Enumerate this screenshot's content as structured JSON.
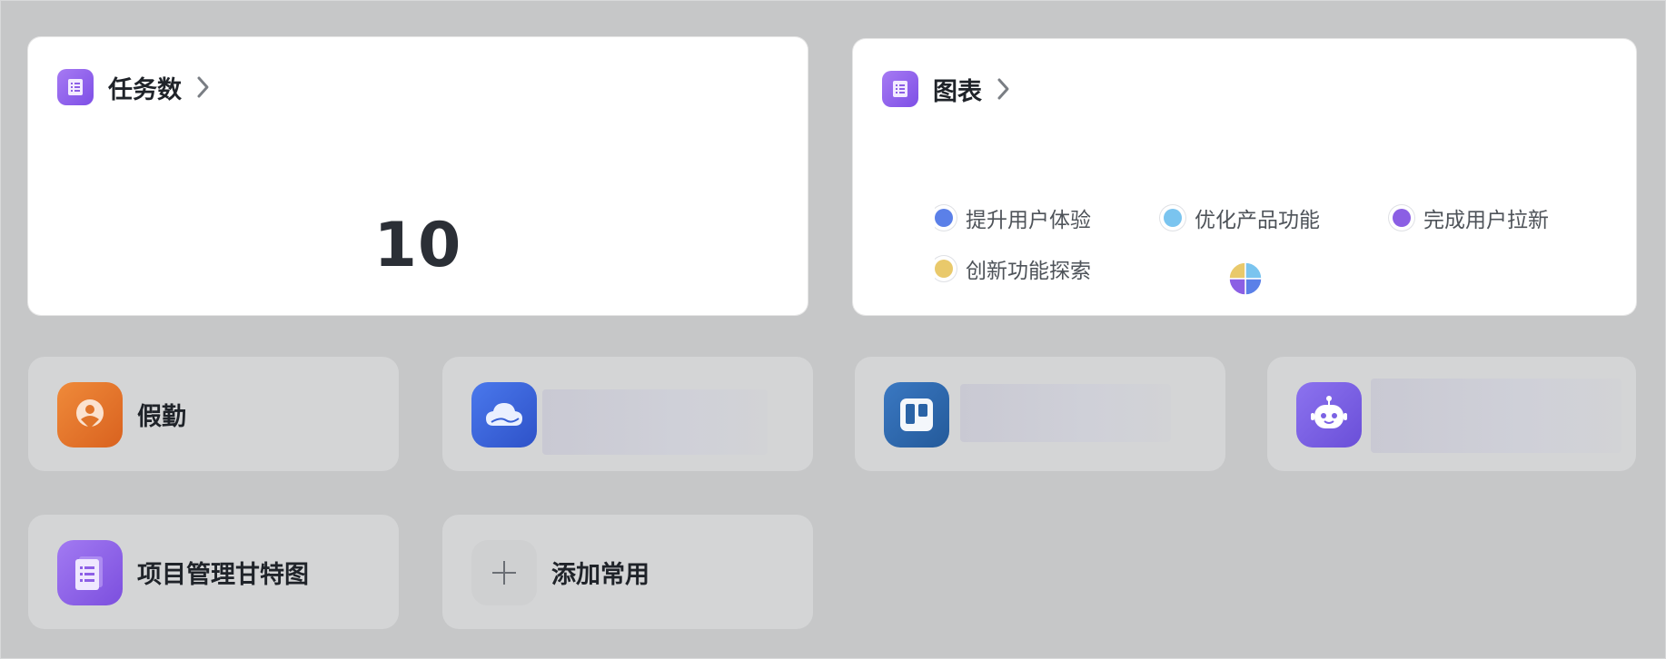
{
  "task_card": {
    "title": "任务数",
    "value": "10"
  },
  "chart_card": {
    "title": "图表"
  },
  "chart_data": {
    "type": "pie",
    "categories": [
      "提升用户体验",
      "优化产品功能",
      "完成用户拉新",
      "创新功能探索"
    ],
    "values": [
      25,
      25,
      25,
      25
    ],
    "colors": [
      "#5b80e8",
      "#7ac4ef",
      "#8b5fe4",
      "#e9c96b"
    ],
    "legend": "top"
  },
  "legend_items": [
    {
      "label": "提升用户体验",
      "color": "#5b80e8"
    },
    {
      "label": "优化产品功能",
      "color": "#7ac4ef"
    },
    {
      "label": "完成用户拉新",
      "color": "#8b5fe4"
    },
    {
      "label": "创新功能探索",
      "color": "#e9c96b"
    }
  ],
  "shortcuts": [
    {
      "label": "假勤",
      "icon": "person-pin-icon",
      "color": "#e0742a"
    },
    {
      "label": "",
      "icon": "cloud-icon",
      "color": "#3760d6"
    },
    {
      "label": "",
      "icon": "board-icon",
      "color": "#2a63a6"
    },
    {
      "label": "",
      "icon": "robot-icon",
      "color": "#7b62e4"
    },
    {
      "label": "项目管理甘特图",
      "icon": "doc-icon",
      "color": "#8d5fe6"
    },
    {
      "label": "添加常用",
      "icon": "plus-icon",
      "color": "#cfd0d1"
    }
  ]
}
